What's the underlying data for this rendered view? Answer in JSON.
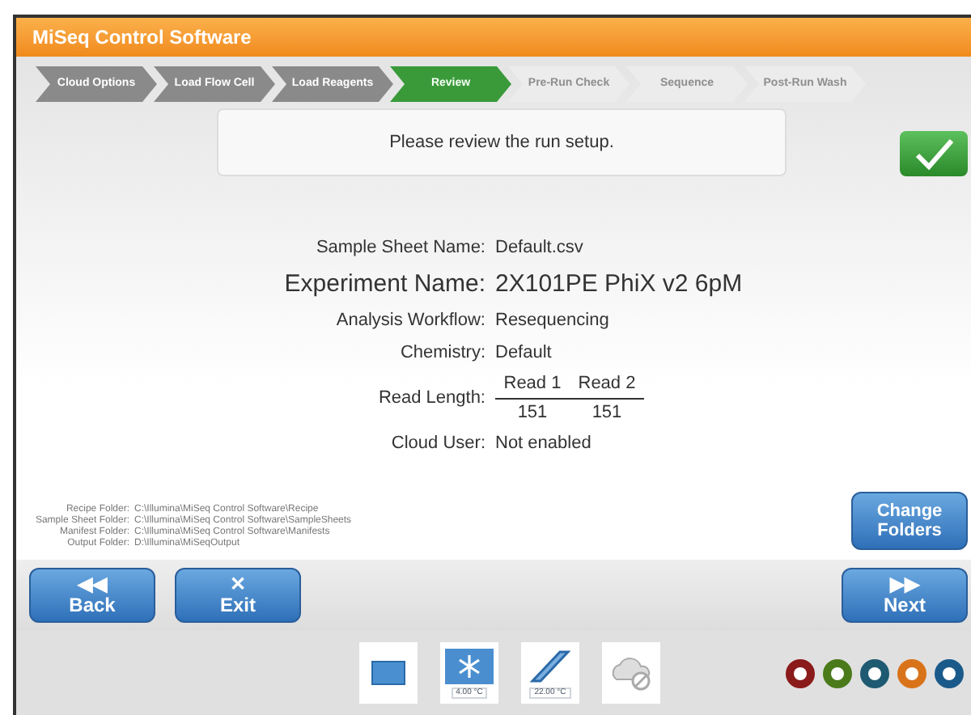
{
  "window": {
    "title": "MiSeq Control Software"
  },
  "steps": [
    {
      "label": "Cloud Options",
      "completed": true,
      "selected": false
    },
    {
      "label": "Load Flow Cell",
      "completed": true,
      "selected": false
    },
    {
      "label": "Load Reagents",
      "completed": true,
      "selected": false
    },
    {
      "label": "Review",
      "completed": false,
      "selected": true
    },
    {
      "label": "Pre-Run Check",
      "completed": false,
      "selected": false
    },
    {
      "label": "Sequence",
      "completed": false,
      "selected": false
    },
    {
      "label": "Post-Run Wash",
      "completed": false,
      "selected": false
    }
  ],
  "message": "Please review the run setup.",
  "summary": [
    {
      "kind": "plain",
      "label": "Sample Sheet Name:",
      "value": "Default.csv"
    },
    {
      "kind": "large",
      "label": "Experiment Name:",
      "value": "2X101PE PhiX v2 6pM"
    },
    {
      "kind": "plain",
      "label": "Analysis Workflow:",
      "value": "Resequencing"
    },
    {
      "kind": "plain",
      "label": "Chemistry:",
      "value": "Default"
    },
    {
      "kind": "reads",
      "label": "Read Length:",
      "reads": [
        {
          "name": "Read 1",
          "length": "151"
        },
        {
          "name": "Read 2",
          "length": "151"
        }
      ]
    },
    {
      "kind": "plain",
      "label": "Cloud User:",
      "value": "Not enabled"
    }
  ],
  "folders": [
    {
      "label": "Recipe Folder:",
      "path": "C:\\Illumina\\MiSeq Control Software\\Recipe"
    },
    {
      "label": "Sample Sheet Folder:",
      "path": "C:\\Illumina\\MiSeq Control Software\\SampleSheets"
    },
    {
      "label": "Manifest Folder:",
      "path": "C:\\Illumina\\MiSeq Control Software\\Manifests"
    },
    {
      "label": "Output Folder:",
      "path": "D:\\Illumina\\MiSeqOutput"
    }
  ],
  "change_folders_button": "Change Folders",
  "nav": {
    "back": {
      "icon": "◀◀",
      "label": "Back"
    },
    "exit": {
      "icon": "✕",
      "label": "Exit"
    },
    "next": {
      "icon": "▶▶",
      "label": "Next"
    }
  },
  "status_icons": [
    {
      "kind": "flowcell"
    },
    {
      "kind": "reagent",
      "reading": "4.00 °C"
    },
    {
      "kind": "flowcell-temp",
      "reading": "22.00 °C"
    },
    {
      "kind": "cloud"
    }
  ],
  "status_dots": [
    {
      "color": "#8b1a1a"
    },
    {
      "color": "#4a7a1a"
    },
    {
      "color": "#1e5a72"
    },
    {
      "color": "#d9731a"
    },
    {
      "color": "#1a5a8a"
    }
  ]
}
